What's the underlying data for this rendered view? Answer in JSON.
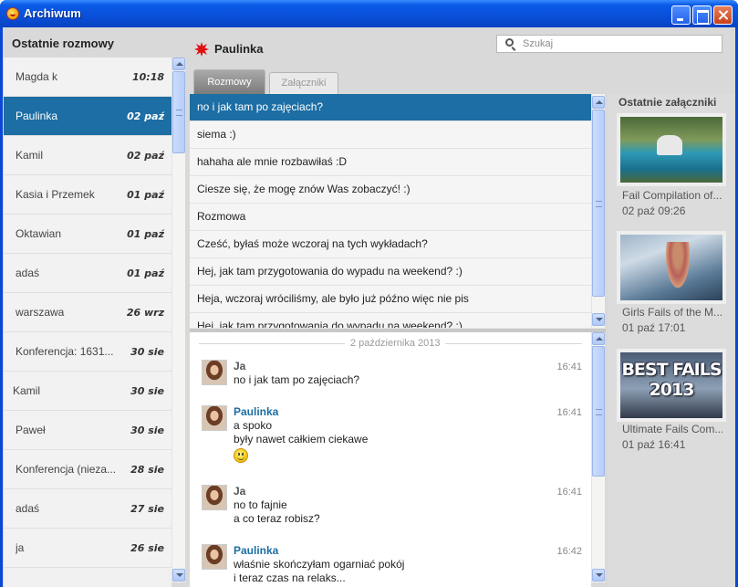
{
  "window": {
    "title": "Archiwum"
  },
  "left": {
    "header": "Ostatnie rozmowy",
    "conversations": [
      {
        "name": "Magda k",
        "date": "10:18"
      },
      {
        "name": "Paulinka",
        "date": "02 paź"
      },
      {
        "name": "Kamil",
        "date": "02 paź"
      },
      {
        "name": "Kasia i Przemek",
        "date": "01 paź"
      },
      {
        "name": "Oktawian",
        "date": "01 paź"
      },
      {
        "name": "adaś",
        "date": "01 paź"
      },
      {
        "name": "warszawa",
        "date": "26 wrz"
      },
      {
        "name": "Konferencja: 1631...",
        "date": "30 sie"
      },
      {
        "name": "Kamil",
        "date": "30 sie"
      },
      {
        "name": "Paweł",
        "date": "30 sie"
      },
      {
        "name": "Konferencja (nieza...",
        "date": "28 sie"
      },
      {
        "name": "adaś",
        "date": "27 sie"
      },
      {
        "name": "ja",
        "date": "26 sie"
      }
    ]
  },
  "header": {
    "contact_name": "Paulinka",
    "search_placeholder": "Szukaj"
  },
  "tabs": [
    {
      "label": "Rozmowy"
    },
    {
      "label": "Załączniki"
    }
  ],
  "messages": [
    "no i jak tam po zajęciach?",
    "siema :)",
    "hahaha ale mnie rozbawiłaś :D",
    "Ciesze się, że mogę znów Was zobaczyć! :)",
    "Rozmowa",
    "Cześć, byłaś może wczoraj na tych wykładach?",
    "Hej, jak tam przygotowania do wypadu na weekend? :)",
    "Heja, wczoraj wróciliśmy, ale było już późno więc nie pis",
    "Hej, jak tam przygotowania do wypadu na weekend? :)"
  ],
  "conversation": {
    "date_separator": "2 października 2013",
    "entries": [
      {
        "who": "Ja",
        "time": "16:41",
        "lines": [
          "no i jak tam po zajęciach?"
        ]
      },
      {
        "who": "Paulinka",
        "time": "16:41",
        "lines": [
          "a spoko",
          "były nawet całkiem ciekawe"
        ],
        "emoticon": "smiley-icon"
      },
      {
        "who": "Ja",
        "time": "16:41",
        "lines": [
          "no to fajnie",
          "a co teraz robisz?"
        ]
      },
      {
        "who": "Paulinka",
        "time": "16:42",
        "lines": [
          "właśnie skończyłam ogarniać pokój",
          "i teraz czas na relaks..."
        ]
      }
    ]
  },
  "attachments": {
    "title": "Ostatnie załączniki",
    "items": [
      {
        "name": "Fail Compilation of...",
        "date": "02 paź 09:26"
      },
      {
        "name": "Girls Fails of the M...",
        "date": "01 paź 17:01"
      },
      {
        "name": "Ultimate Fails Com...",
        "date": "01 paź 16:41",
        "thumb_text": [
          "BEST FAILS",
          "2013"
        ]
      }
    ]
  },
  "colors": {
    "selection": "#1c6ea4",
    "titlebar": "#0a4fd9",
    "contact_star": "#e01010"
  }
}
